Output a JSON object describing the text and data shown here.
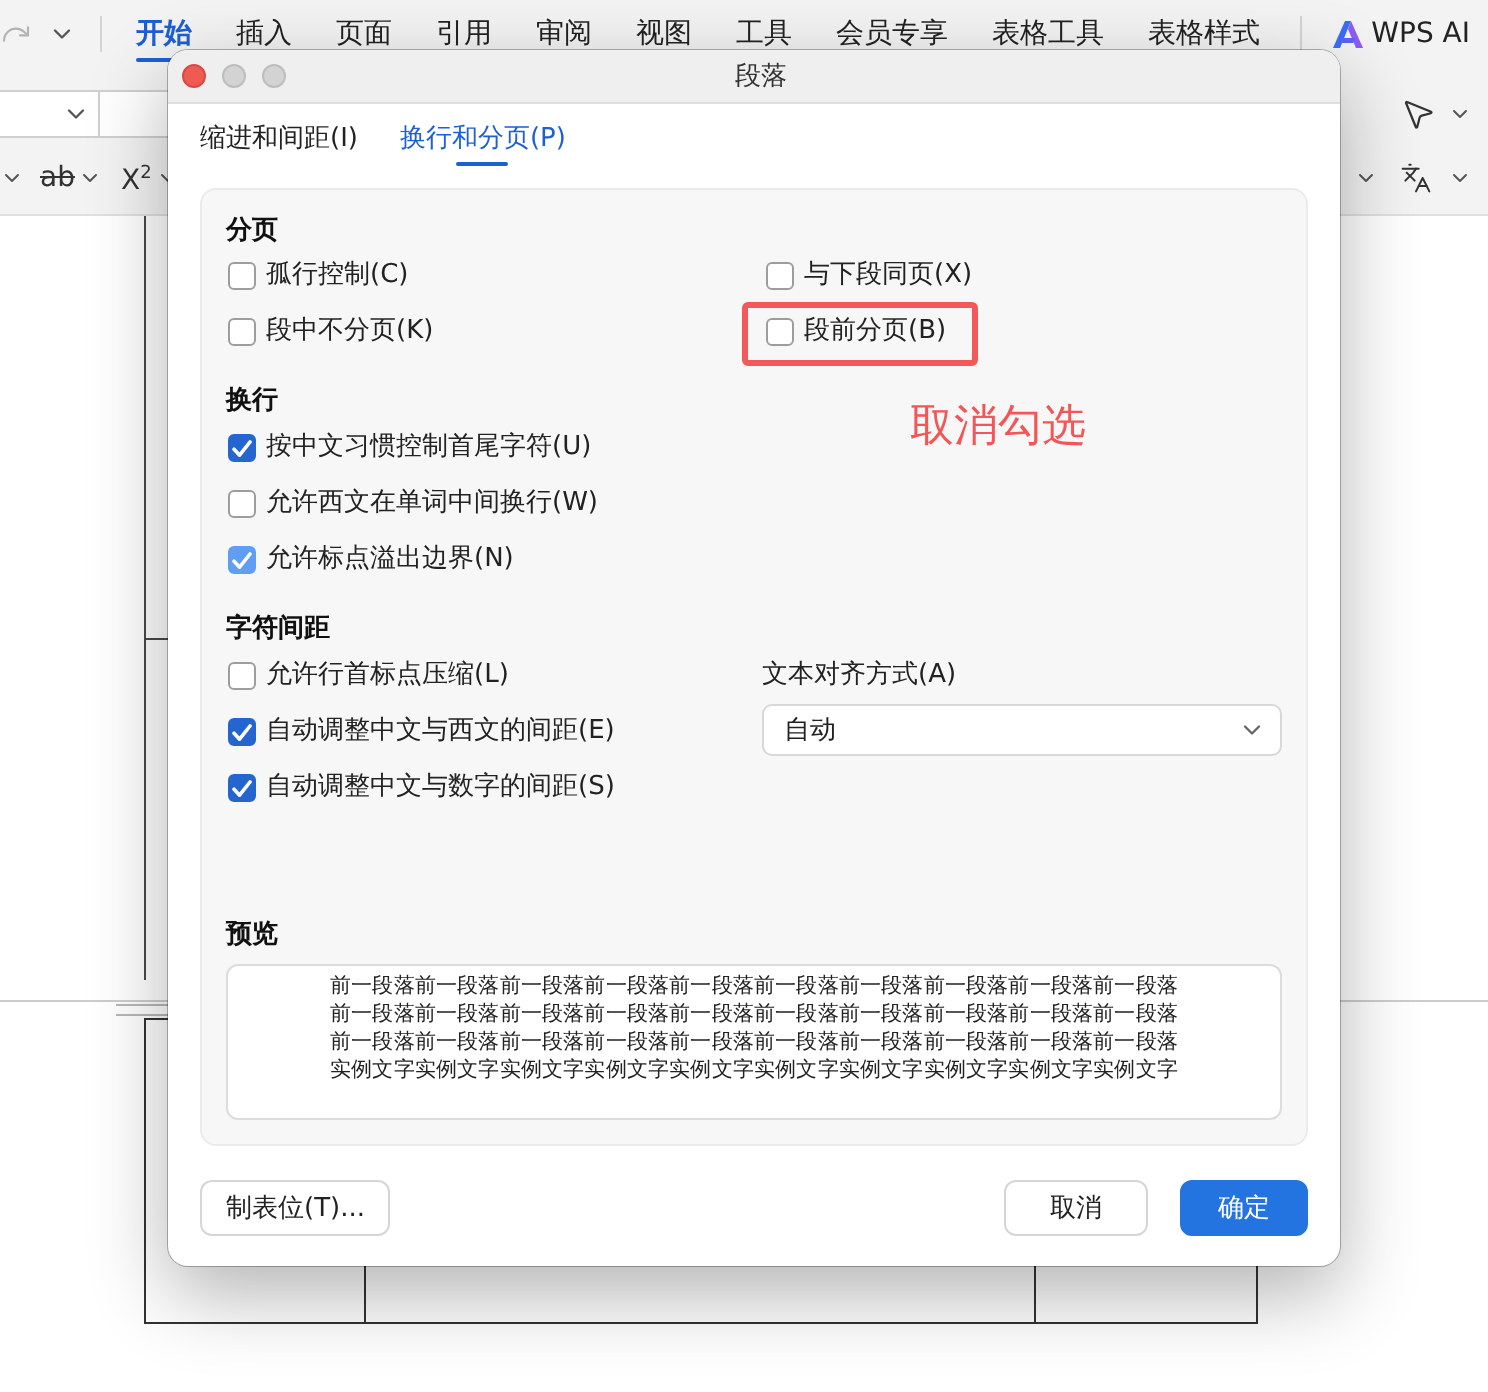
{
  "ribbon": {
    "tabs": [
      {
        "label": "开始",
        "selected": true
      },
      {
        "label": "插入",
        "selected": false
      },
      {
        "label": "页面",
        "selected": false
      },
      {
        "label": "引用",
        "selected": false
      },
      {
        "label": "审阅",
        "selected": false
      },
      {
        "label": "视图",
        "selected": false
      },
      {
        "label": "工具",
        "selected": false
      },
      {
        "label": "会员专享",
        "selected": false
      },
      {
        "label": "表格工具",
        "selected": false
      },
      {
        "label": "表格样式",
        "selected": false
      }
    ],
    "ai_button": {
      "label": "WPS AI"
    }
  },
  "toolbar": {
    "tools": [
      {
        "label": "ab",
        "kind": "strikethrough"
      },
      {
        "label": "X$^{2}$",
        "kind": "superscript"
      }
    ]
  },
  "dialog": {
    "title": "段落",
    "tabs": [
      {
        "label": "缩进和间距(I)",
        "selected": false
      },
      {
        "label": "换行和分页(P)",
        "selected": true
      }
    ],
    "pagination": {
      "heading": "分页",
      "options": [
        {
          "label": "孤行控制(C)",
          "checked": false,
          "annotated": false
        },
        {
          "label": "与下段同页(X)",
          "checked": false,
          "annotated": false
        },
        {
          "label": "段中不分页(K)",
          "checked": false,
          "annotated": false
        },
        {
          "label": "段前分页(B)",
          "checked": false,
          "annotated": true
        }
      ]
    },
    "annotation": {
      "text": "取消勾选"
    },
    "line_breaking": {
      "heading": "换行",
      "options": [
        {
          "label": "按中文习惯控制首尾字符(U)",
          "checked": true,
          "dimmed": false
        },
        {
          "label": "允许西文在单词中间换行(W)",
          "checked": false,
          "dimmed": false
        },
        {
          "label": "允许标点溢出边界(N)",
          "checked": true,
          "dimmed": true
        }
      ]
    },
    "character_spacing": {
      "heading": "字符间距",
      "options": [
        {
          "label": "允许行首标点压缩(L)",
          "checked": false
        },
        {
          "label": "自动调整中文与西文的间距(E)",
          "checked": true
        },
        {
          "label": "自动调整中文与数字的间距(S)",
          "checked": true
        }
      ],
      "alignment": {
        "label": "文本对齐方式(A)",
        "value": "自动"
      }
    },
    "preview": {
      "heading": "预览",
      "previous_paragraph": "前一段落前一段落前一段落前一段落前一段落前一段落前一段落前一段落前一段落前一段落前一段落前一段落前一段落前一段落前一段落前一段落前一段落前一段落前一段落前一段落前一段落前一段落前一段落前一段落前一段落前一段落前一段落前一段落前一段落前一段落",
      "sample_text": "实例文字实例文字实例文字实例文字实例文字实例文字实例文字实例文字实例文字实例文字"
    },
    "footer": {
      "left": [
        {
          "label": "制表位(T)...",
          "kind": "default"
        }
      ],
      "right": [
        {
          "label": "取消",
          "kind": "default"
        },
        {
          "label": "确定",
          "kind": "primary"
        }
      ]
    }
  }
}
